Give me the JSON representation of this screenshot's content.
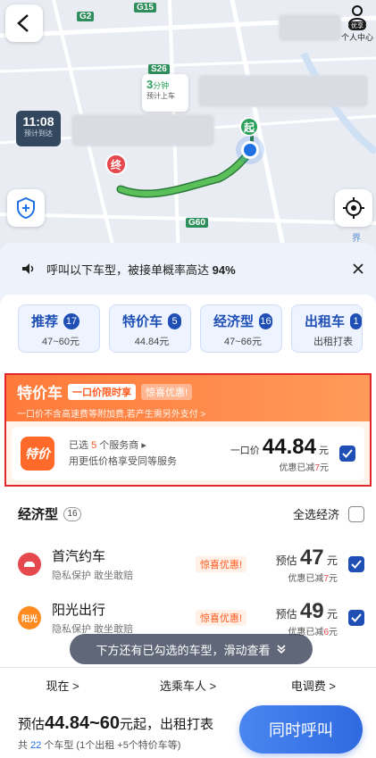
{
  "map": {
    "roads": [
      "G2",
      "G15",
      "S26",
      "G60"
    ],
    "eta_to_pickup": {
      "minutes": "3",
      "unit": "分钟",
      "label": "预计上车"
    },
    "arrival": {
      "time": "11:08",
      "label": "预计到达"
    },
    "pin_start": "起",
    "pin_end": "终",
    "profile": {
      "badge": "优享",
      "label": "个人中心"
    },
    "edge_text": "界"
  },
  "notice": {
    "prefix": "呼叫以下车型，被接单概率高达 ",
    "percent": "94%"
  },
  "tabs": [
    {
      "name": "推荐",
      "count": "17",
      "sub": "47~60元"
    },
    {
      "name": "特价车",
      "count": "5",
      "sub": "44.84元"
    },
    {
      "name": "经济型",
      "count": "16",
      "sub": "47~66元"
    },
    {
      "name": "出租车",
      "count": "1",
      "sub": "出租打表"
    }
  ],
  "special": {
    "title": "特价车",
    "tag_fixed": "一口价限时享",
    "tag_surprise": "惊喜优惠!",
    "desc": "一口价不含高速费等附加费,若产生需另外支付 >",
    "logo_text": "特价",
    "selected_prefix": "已选",
    "selected_count": "5",
    "selected_suffix": "个服务商",
    "selected_desc": "用更低价格享受同等服务",
    "price_label": "一口价",
    "price": "44.84",
    "price_unit": "元",
    "discount_label": "优惠已减",
    "discount": "7",
    "discount_unit": "元"
  },
  "economy": {
    "title": "经济型",
    "count": "16",
    "select_all": "全选经济",
    "rows": [
      {
        "name": "首汽约车",
        "desc": "隐私保护  敢坐敢赔",
        "pill": "惊喜优惠!",
        "label": "预估",
        "price": "47",
        "unit": "元",
        "discount_label": "优惠已减",
        "discount": "7",
        "discount_unit": "元",
        "color": "#e5484d"
      },
      {
        "name": "阳光出行",
        "desc": "隐私保护  敢坐敢赔",
        "pill": "惊喜优惠!",
        "label": "预估",
        "price": "49",
        "unit": "元",
        "discount_label": "优惠已减",
        "discount": "6",
        "discount_unit": "元",
        "color": "#ff8a1f",
        "logo_text": "阳光"
      }
    ]
  },
  "toast": "下方还有已勾选的车型，滑动查看",
  "options": {
    "time": "现在 >",
    "rider": "选乘车人 >",
    "payment": "电调费 >"
  },
  "footer": {
    "est_prefix": "预估",
    "range": "44.84~60",
    "est_suffix": "元起，出租打表",
    "count_prefix": "共",
    "count": "22",
    "count_suffix": "个车型 (1个出租 +5个特价车等)",
    "call": "同时呼叫"
  }
}
